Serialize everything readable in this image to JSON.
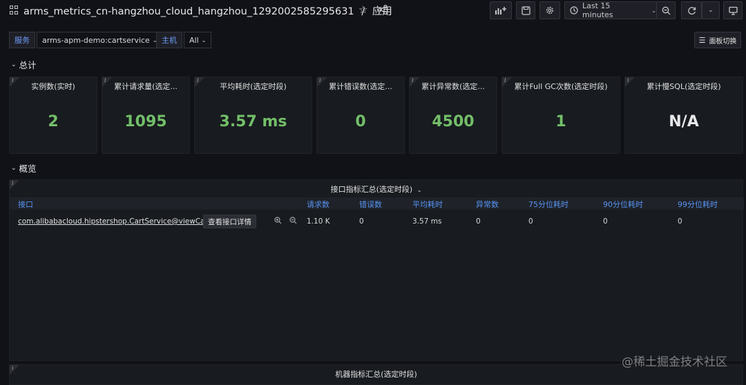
{
  "header": {
    "title": "arms_metrics_cn-hangzhou_cloud_hangzhou_1292002585295631",
    "separator": "/",
    "folder": "应用",
    "time_range": "Last 15 minutes"
  },
  "variables": {
    "service_label": "服务",
    "service_value": "arms-apm-demo:cartservice",
    "host_label": "主机",
    "host_value": "All",
    "panel_switch": "面板切换"
  },
  "rows": {
    "summary": "总计",
    "overview": "概览"
  },
  "stats": [
    {
      "title": "实例数(实时)",
      "value": "2"
    },
    {
      "title": "累计请求量(选定...",
      "value": "1095"
    },
    {
      "title": "平均耗时(选定时段)",
      "value": "3.57 ms"
    },
    {
      "title": "累计错误数(选定...",
      "value": "0"
    },
    {
      "title": "累计异常数(选定...",
      "value": "4500"
    },
    {
      "title": "累计Full GC次数(选定时段)",
      "value": "1"
    },
    {
      "title": "累计慢SQL(选定时段)",
      "value": "N/A"
    }
  ],
  "interface_panel": {
    "title": "接口指标汇总(选定时段)",
    "columns": [
      "接口",
      "请求数",
      "错误数",
      "平均耗时",
      "异常数",
      "75分位耗时",
      "90分位耗时",
      "99分位耗时"
    ],
    "row": {
      "interface": "com.alibabacloud.hipstershop.CartService@viewCart",
      "detail_button": "查看接口详情",
      "requests": "1.10 K",
      "errors": "0",
      "avg": "3.57 ms",
      "exceptions": "0",
      "p75": "0",
      "p90": "0",
      "p99": "0"
    }
  },
  "machine_panel": {
    "title": "机器指标汇总(选定时段)"
  },
  "watermark": "@稀土掘金技术社区",
  "colors": {
    "background": "#111217",
    "panel": "#181b1f",
    "stat_green": "#73bf69",
    "header_blue": "#5794f2"
  }
}
